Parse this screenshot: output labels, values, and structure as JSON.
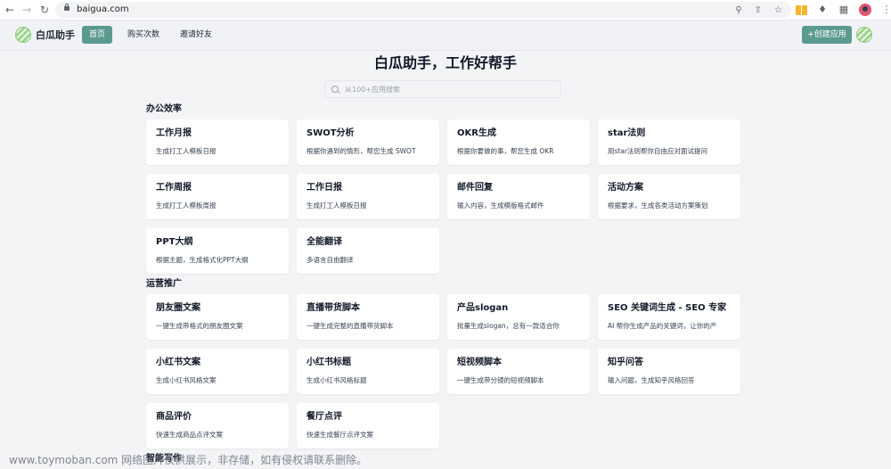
{
  "browser": {
    "url": "baigua.com"
  },
  "header": {
    "logo_text": "白瓜助手",
    "nav": [
      "首页",
      "购买次数",
      "邀请好友"
    ],
    "create_button": "+创建应用"
  },
  "main": {
    "title": "白瓜助手，工作好帮手",
    "search_placeholder": "从100+应用搜索",
    "sections": [
      {
        "title": "办公效率",
        "cards": [
          {
            "title": "工作月报",
            "desc": "生成打工人模板日报"
          },
          {
            "title": "SWOT分析",
            "desc": "根据你遇到的情形，帮您生成 SWOT"
          },
          {
            "title": "OKR生成",
            "desc": "根据你要做的事，帮您生成 OKR"
          },
          {
            "title": "star法则",
            "desc": "用star法则帮你自由应对面试提问"
          },
          {
            "title": "工作周报",
            "desc": "生成打工人模板周报"
          },
          {
            "title": "工作日报",
            "desc": "生成打工人模板日报"
          },
          {
            "title": "邮件回复",
            "desc": "输入内容，生成模版格式邮件"
          },
          {
            "title": "活动方案",
            "desc": "根据要求，生成各类活动方案策划"
          },
          {
            "title": "PPT大纲",
            "desc": "根据主题，生成格式化PPT大纲"
          },
          {
            "title": "全能翻译",
            "desc": "多语言自由翻译"
          }
        ]
      },
      {
        "title": "运营推广",
        "cards": [
          {
            "title": "朋友圈文案",
            "desc": "一键生成带格式的朋友圈文案"
          },
          {
            "title": "直播带货脚本",
            "desc": "一键生成完整的直播带货脚本"
          },
          {
            "title": "产品slogan",
            "desc": "批量生成slogan，总有一款适合你"
          },
          {
            "title": "SEO 关键词生成 - SEO 专家",
            "desc": "AI 帮你生成产品的关键词，让你的产"
          },
          {
            "title": "小红书文案",
            "desc": "生成小红书风格文案"
          },
          {
            "title": "小红书标题",
            "desc": "生成小红书风格标题"
          },
          {
            "title": "短视频脚本",
            "desc": "一键生成带分镜的短视频脚本"
          },
          {
            "title": "知乎问答",
            "desc": "输入问题，生成知乎风格回答"
          },
          {
            "title": "商品评价",
            "desc": "快速生成商品点评文案"
          },
          {
            "title": "餐厅点评",
            "desc": "快速生成餐厅点评文案"
          }
        ]
      },
      {
        "title": "智能写作",
        "cards": []
      }
    ]
  },
  "watermark": "www.toymoban.com 网络图片仅供展示，非存储，如有侵权请联系删除。",
  "colors": {
    "accent": "#5b9a90",
    "background": "#f3f4f6",
    "card": "#ffffff"
  }
}
